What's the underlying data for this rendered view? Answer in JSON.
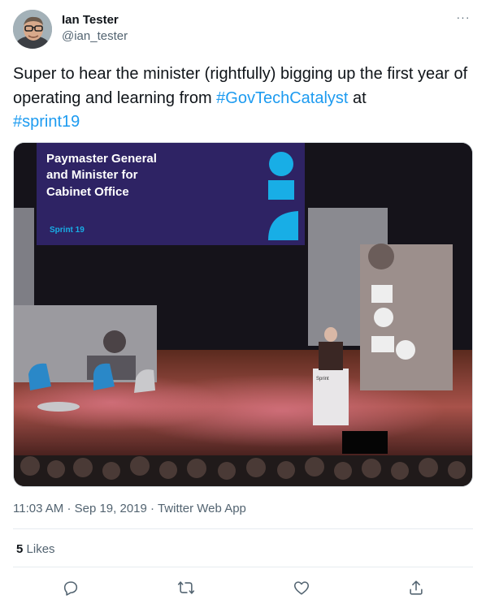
{
  "author": {
    "display_name": "Ian Tester",
    "handle": "@ian_tester",
    "avatar_icon": "user-avatar-photo"
  },
  "menu": {
    "more_label": "···"
  },
  "tweet": {
    "text_plain_1": "Super to hear the minister (rightfully) bigging up the first year of operating and learning from ",
    "hashtag_1": "#GovTechCatalyst",
    "text_plain_2": " at ",
    "hashtag_2": "#sprint19"
  },
  "media": {
    "screen_text_line1": "Paymaster General",
    "screen_text_line2": "and Minister for",
    "screen_text_line3": "Cabinet Office",
    "screen_brand": "Sprint 19",
    "podium_label": "Sprint"
  },
  "meta": {
    "time": "11:03 AM",
    "separator": "·",
    "date": "Sep 19, 2019",
    "source": "Twitter Web App"
  },
  "engagement": {
    "likes_count": "5",
    "likes_label": "Likes"
  },
  "actions": {
    "reply_icon": "reply-icon",
    "retweet_icon": "retweet-icon",
    "like_icon": "heart-icon",
    "share_icon": "share-icon"
  },
  "colors": {
    "link": "#1d9bf0",
    "secondary_text": "#536471",
    "primary_text": "#0f1419",
    "screen_accent": "#18aee6"
  }
}
